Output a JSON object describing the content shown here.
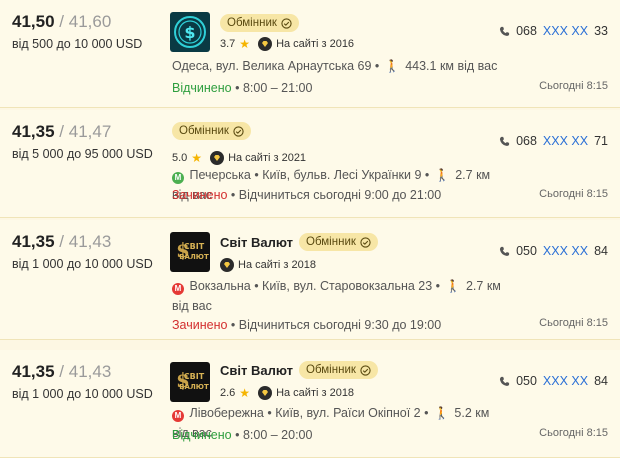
{
  "offers": [
    {
      "buy": "41,50",
      "sell": "41,60",
      "limit": "від 500 до 10 000 USD",
      "name": "",
      "badge": "Обмінник",
      "rating": "3.7",
      "since": "На сайті з 2016",
      "address": "Одеса, вул. Велика Арнаутська 69 •",
      "distance": "443.1 км від вас",
      "status": "Відчинено",
      "status_kind": "open",
      "hours": "• 8:00 – 21:00",
      "phone_prefix": "068",
      "phone_hidden": "XXX XX",
      "phone_suffix": "33",
      "updated": "Сьогодні 8:15",
      "logo": "dollar-logo",
      "metro": ""
    },
    {
      "buy": "41,35",
      "sell": "41,47",
      "limit": "від 5 000 до 95 000 USD",
      "name": "",
      "badge": "Обмінник",
      "rating": "5.0",
      "since": "На сайті з 2021",
      "address": "Печерська • Київ, бульв. Лесі Українки 9 •",
      "distance": "2.7 км від вас",
      "status": "Зачинено",
      "status_kind": "closed",
      "hours": "• Відчиниться сьогодні 9:00 до 21:00",
      "phone_prefix": "068",
      "phone_hidden": "XXX XX",
      "phone_suffix": "71",
      "updated": "Сьогодні 8:15",
      "logo": "",
      "metro": "green"
    },
    {
      "buy": "41,35",
      "sell": "41,43",
      "limit": "від 1 000 до 10 000 USD",
      "name": "Світ Валют",
      "badge": "Обмінник",
      "rating": "",
      "since": "На сайті з 2018",
      "address": "Вокзальна • Київ, вул. Старовокзальна 23 •",
      "distance": "2.7 км від вас",
      "status": "Зачинено",
      "status_kind": "closed",
      "hours": "• Відчиниться сьогодні 9:30 до 19:00",
      "phone_prefix": "050",
      "phone_hidden": "XXX XX",
      "phone_suffix": "84",
      "updated": "Сьогодні 8:15",
      "logo": "svit-valut-logo",
      "metro": "red"
    },
    {
      "buy": "41,35",
      "sell": "41,43",
      "limit": "від 1 000 до 10 000 USD",
      "name": "Світ Валют",
      "badge": "Обмінник",
      "rating": "2.6",
      "since": "На сайті з 2018",
      "address": "Лівобережна • Київ, вул. Раїси Окіпної 2 •",
      "distance": "5.2 км від вас",
      "status": "Відчинено",
      "status_kind": "open",
      "hours": "• 8:00 – 20:00",
      "phone_prefix": "050",
      "phone_hidden": "XXX XX",
      "phone_suffix": "84",
      "updated": "Сьогодні 8:15",
      "logo": "svit-valut-logo",
      "metro": "red"
    }
  ],
  "logo_text": {
    "line1": "СВІТ",
    "line2": "ВАЛЮТ"
  },
  "metro_letter": "М",
  "colors": {
    "accent_open": "#2e9e3e",
    "accent_closed": "#d32f2f",
    "phone_link": "#2a6fd6",
    "badge_bg": "#f7e6a6",
    "star": "#f5b400"
  }
}
